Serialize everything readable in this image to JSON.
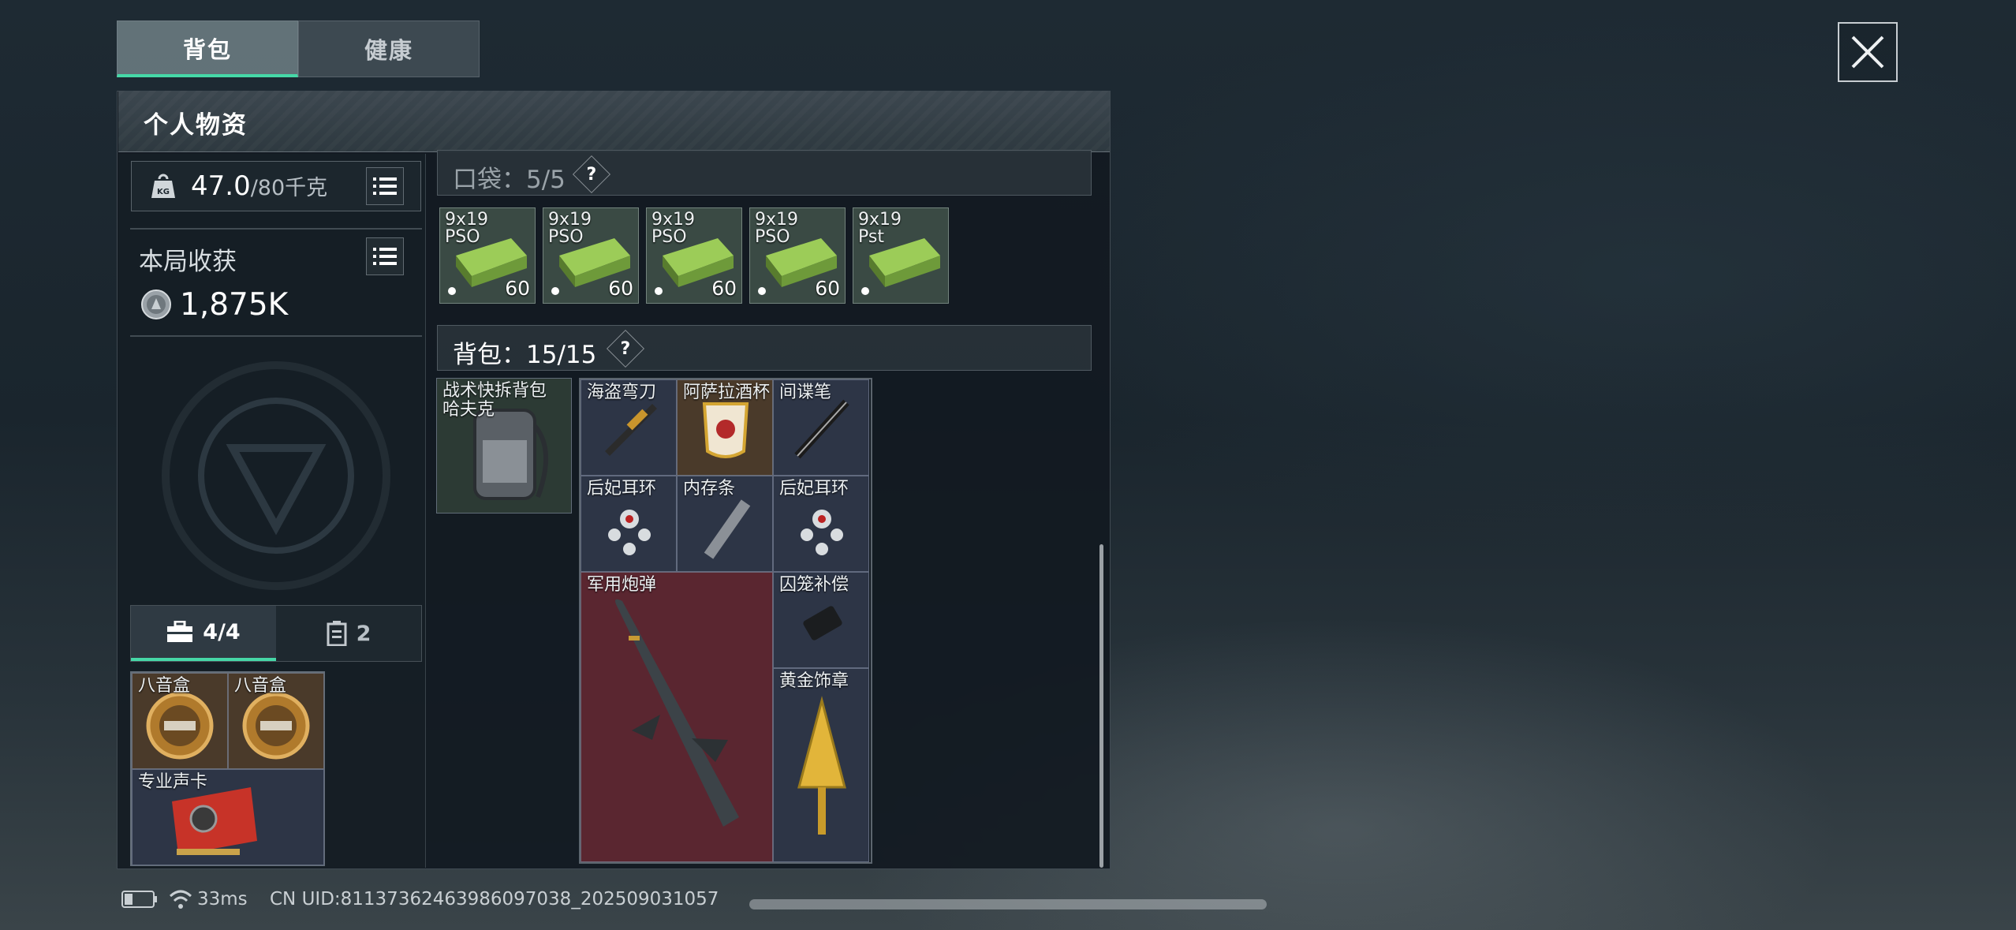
{
  "tabs": [
    {
      "label": "背包",
      "active": true
    },
    {
      "label": "健康",
      "active": false
    }
  ],
  "panel": {
    "title": "个人物资"
  },
  "weight": {
    "current": "47.0",
    "max": "/80千克"
  },
  "haul": {
    "label": "本局收获",
    "value": "1,875K"
  },
  "sub_tabs": [
    {
      "label": "4/4",
      "icon": "briefcase-icon",
      "active": true
    },
    {
      "label": "2",
      "icon": "id-card-icon",
      "active": false
    }
  ],
  "secure_case": {
    "items": [
      {
        "name": "八音盒"
      },
      {
        "name": "八音盒"
      },
      {
        "name": "专业声卡"
      }
    ]
  },
  "pocket": {
    "label": "口袋：5/5",
    "help": "?",
    "ammo": [
      {
        "name_line1": "9x19",
        "name_line2": "PSO",
        "count": "60"
      },
      {
        "name_line1": "9x19",
        "name_line2": "PSO",
        "count": "60"
      },
      {
        "name_line1": "9x19",
        "name_line2": "PSO",
        "count": "60"
      },
      {
        "name_line1": "9x19",
        "name_line2": "PSO",
        "count": "60"
      },
      {
        "name_line1": "9x19",
        "name_line2": "Pst",
        "count": ""
      }
    ]
  },
  "backpack": {
    "label": "背包：15/15",
    "help": "?",
    "equipped": {
      "name_line1": "战术快拆背包",
      "name_line2": "哈夫克"
    },
    "items": [
      {
        "name": "海盗弯刀"
      },
      {
        "name": "阿萨拉酒杯"
      },
      {
        "name": "间谍笔"
      },
      {
        "name": "后妃耳环"
      },
      {
        "name": "内存条"
      },
      {
        "name": "后妃耳环"
      },
      {
        "name": "军用炮弹"
      },
      {
        "name": "囚笼补偿"
      },
      {
        "name": "黄金饰章"
      }
    ]
  },
  "status_bar": {
    "ping": "33ms",
    "uid": "CN UID:8113736246398609703​8_202509031057"
  },
  "colors": {
    "accent": "#46d8a7",
    "gold_bg": "#4a3a2a",
    "red_bg": "#5a2630"
  }
}
